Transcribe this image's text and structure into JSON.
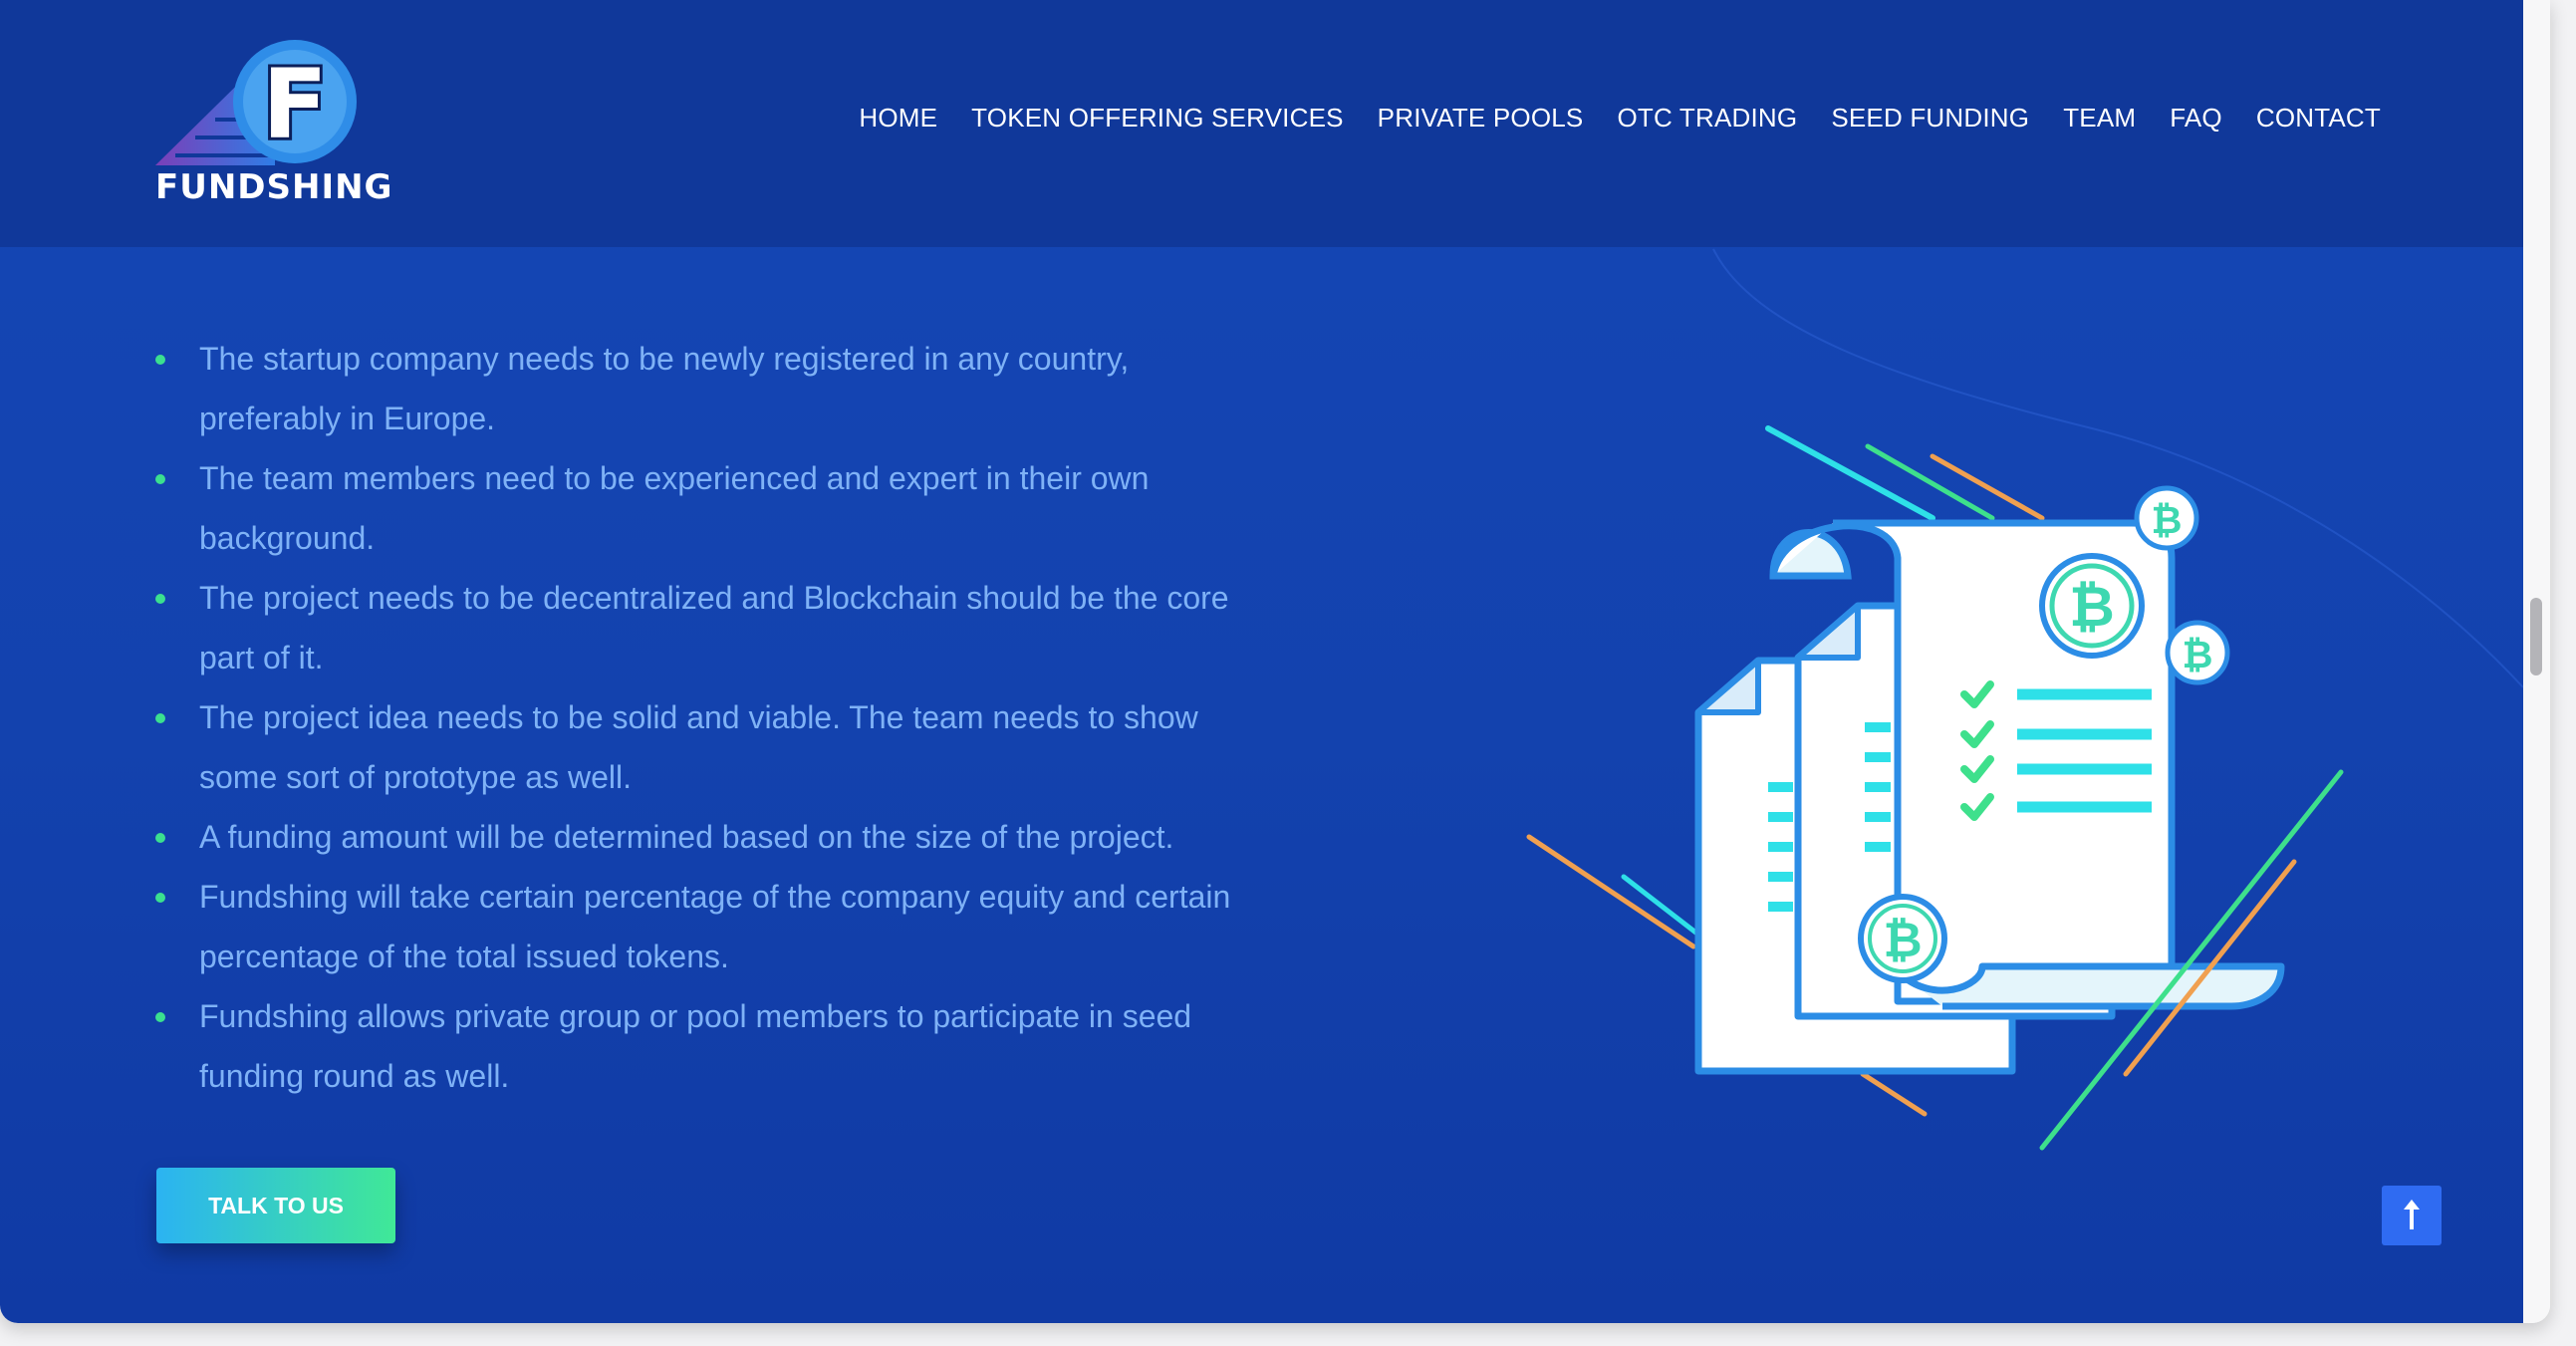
{
  "brand": {
    "name": "FUNDSHING",
    "logo_letter": "F"
  },
  "nav": {
    "items": [
      "HOME",
      "TOKEN OFFERING SERVICES",
      "PRIVATE POOLS",
      "OTC TRADING",
      "SEED FUNDING",
      "TEAM",
      "FAQ",
      "CONTACT"
    ]
  },
  "requirements": [
    "The startup company needs to be newly registered in any country, preferably in Europe.",
    "The team members need to be experienced and expert in their own background.",
    "The project needs to be decentralized and Blockchain should be the core part of it.",
    "The project idea needs to be solid and viable. The team needs to show some sort of prototype as well.",
    "A funding amount will be determined based on the size of the project.",
    "Fundshing will take certain percentage of the company equity and certain percentage of the total issued tokens.",
    "Fundshing allows private group or pool members to participate in seed funding round as well."
  ],
  "cta": {
    "label": "TALK TO US"
  },
  "icons": {
    "illustration": "bitcoin-documents-illustration-icon",
    "back_to_top": "arrow-up-icon"
  },
  "colors": {
    "header": "#10389A",
    "background": "#1547B6",
    "text": "#7FB2F6",
    "bullet": "#3BE08F",
    "accent": "#2F6BF2"
  }
}
